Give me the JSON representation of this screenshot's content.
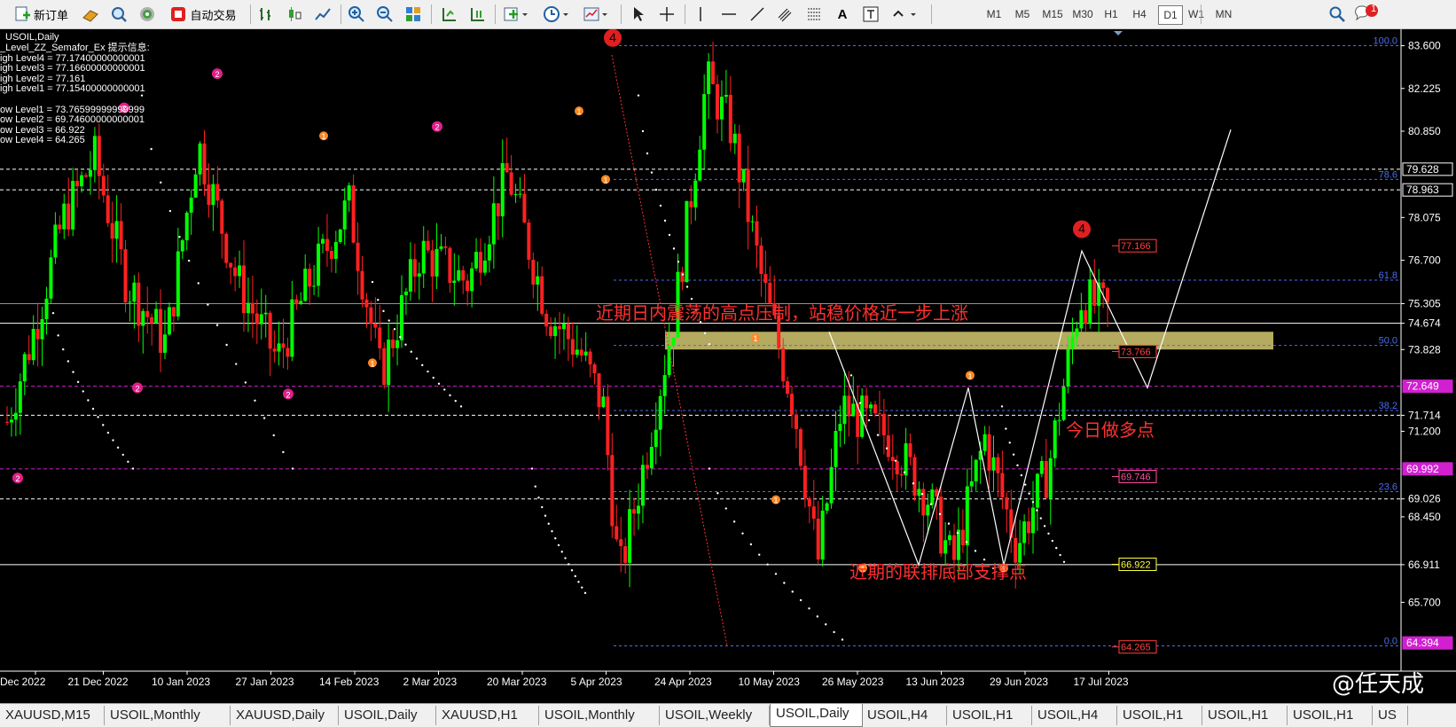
{
  "toolbar": {
    "new_order": "新订单",
    "auto_trade": "自动交易",
    "timeframes": [
      "M1",
      "M5",
      "M15",
      "M30",
      "H1",
      "H4",
      "D1",
      "W1",
      "MN"
    ],
    "active_timeframe": "D1",
    "notify_count": "1"
  },
  "chart": {
    "symbol": "USOIL,Daily",
    "indicator_lines": [
      "_Level_ZZ_Semafor_Ex 提示信息:",
      "igh Level4 = 77.17400000000001",
      "igh Level3 = 77.16600000000001",
      "igh Level2 = 77.161",
      "igh Level1 = 77.15400000000001",
      "",
      "ow Level1 = 73.76599999999999",
      "ow Level2 = 69.74600000000001",
      "ow Level3 = 66.922",
      "ow Level4 = 64.265"
    ],
    "price_scale": {
      "min": 64.0,
      "max": 83.9,
      "ticks": [
        "83.600",
        "82.225",
        "80.850",
        "78.075",
        "76.700",
        "75.305",
        "74.674",
        "73.828",
        "71.714",
        "71.200",
        "69.026",
        "68.450",
        "66.911",
        "65.700"
      ],
      "highlighted": [
        {
          "label": "79.628",
          "color": "#ffffff"
        },
        {
          "label": "78.963",
          "color": "#ffffff"
        },
        {
          "label": "72.649",
          "color": "#d020d0"
        },
        {
          "label": "69.992",
          "color": "#d020d0"
        },
        {
          "label": "64.394",
          "color": "#d020d0"
        }
      ]
    },
    "date_axis": [
      "Dec 2022",
      "21 Dec 2022",
      "10 Jan 2023",
      "27 Jan 2023",
      "14 Feb 2023",
      "2 Mar 2023",
      "20 Mar 2023",
      "5 Apr 2023",
      "24 Apr 2023",
      "10 May 2023",
      "26 May 2023",
      "13 Jun 2023",
      "29 Jun 2023",
      "17 Jul 2023"
    ],
    "fib_levels": [
      "100.0",
      "78.6",
      "61.8",
      "50.0",
      "38.2",
      "23.6",
      "0.0"
    ],
    "level_tags": [
      {
        "text": "77.166",
        "color": "#ff4040"
      },
      {
        "text": "73.766",
        "color": "#ff4040"
      },
      {
        "text": "69.746",
        "color": "#ff4fa0"
      },
      {
        "text": "66.922",
        "color": "#ffff40"
      },
      {
        "text": "64.265",
        "color": "#ff4040"
      }
    ],
    "annotations": {
      "resistance": "近期日内震荡的高点压制，站稳价格近一步上涨",
      "buy_point": "今日做多点",
      "support": "近期的联排底部支撑点"
    },
    "colors": {
      "up": "#00ff00",
      "down": "#ff2020",
      "zone": "#c8bc6a",
      "fib": "#4a6cf0",
      "white": "#ffffff"
    }
  },
  "tabs": [
    {
      "label": "XAUUSD,M15",
      "active": false
    },
    {
      "label": "USOIL,Monthly",
      "active": false
    },
    {
      "label": "XAUUSD,Daily",
      "active": false
    },
    {
      "label": "USOIL,Daily",
      "active": false
    },
    {
      "label": "XAUUSD,H1",
      "active": false
    },
    {
      "label": "USOIL,Monthly",
      "active": false
    },
    {
      "label": "USOIL,Weekly",
      "active": false
    },
    {
      "label": "USOIL,Daily",
      "active": true
    },
    {
      "label": "USOIL,H4",
      "active": false
    },
    {
      "label": "USOIL,H1",
      "active": false
    },
    {
      "label": "USOIL,H4",
      "active": false
    },
    {
      "label": "USOIL,H1",
      "active": false
    },
    {
      "label": "USOIL,H1",
      "active": false
    },
    {
      "label": "USOIL,H1",
      "active": false
    },
    {
      "label": "US",
      "active": false
    }
  ],
  "watermark": "@任天成"
}
